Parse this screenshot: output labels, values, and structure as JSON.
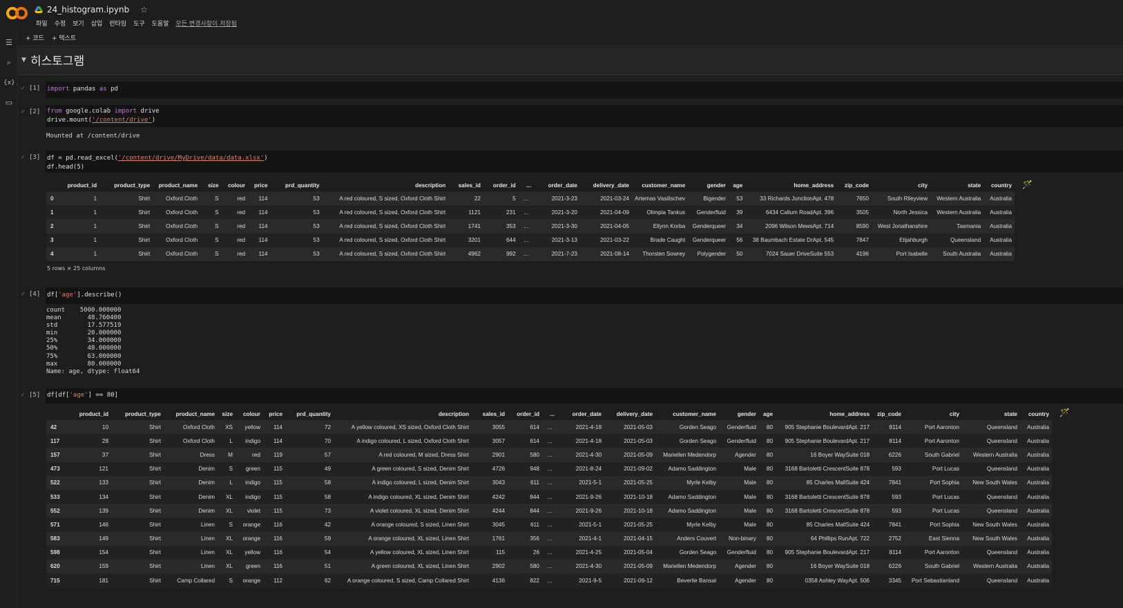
{
  "header": {
    "notebook_title": "24_histogram.ipynb",
    "menu": [
      "파일",
      "수정",
      "보기",
      "삽입",
      "런타임",
      "도구",
      "도움말"
    ],
    "save_status": "모든 변경사항이 저장됨"
  },
  "toolbar": {
    "add_code": "+ 코드",
    "add_text": "+ 텍스트"
  },
  "section": {
    "title": "히스토그램"
  },
  "cells": {
    "c1": {
      "exec": "[1]",
      "kw1": "import",
      "mid": " pandas ",
      "kw2": "as",
      "end": " pd"
    },
    "c2": {
      "exec": "[2]",
      "kw1": "from",
      "mid1": " google.colab ",
      "kw2": "import",
      "end1": " drive",
      "l2a": "drive.mount(",
      "l2str": "'/content/drive'",
      "l2b": ")",
      "output": "Mounted at /content/drive"
    },
    "c3": {
      "exec": "[3]",
      "l1a": "df = pd.read_excel(",
      "l1str": "'/content/drive/MyDrive/data/data.xlsx'",
      "l1b": ")",
      "l2": "df.head(5)",
      "shape_note": "5 rows × 25 columns"
    },
    "c4": {
      "exec": "[4]",
      "l1a": "df[",
      "l1str": "'age'",
      "l1b": "].describe()",
      "output": "count    5000.000000\nmean       48.760400\nstd        17.577519\nmin        20.000000\n25%        34.000000\n50%        48.000000\n75%        63.000000\nmax        80.000000\nName: age, dtype: float64"
    },
    "c5": {
      "exec": "[5]",
      "l1a": "df[df[",
      "l1str": "'age'",
      "l1b": "] == 80]"
    }
  },
  "table1": {
    "columns": [
      "",
      "product_id",
      "product_type",
      "product_name",
      "size",
      "colour",
      "price",
      "prd_quantity",
      "description",
      "sales_id",
      "order_id",
      "...",
      "order_date",
      "delivery_date",
      "customer_name",
      "gender",
      "age",
      "home_address",
      "zip_code",
      "city",
      "state",
      "country"
    ],
    "rows": [
      [
        "0",
        "1",
        "Shirt",
        "Oxford Cloth",
        "S",
        "red",
        "114",
        "53",
        "A red coloured, S sized, Oxford Cloth Shirt",
        "22",
        "5",
        "...",
        "2021-3-23",
        "2021-03-24",
        "Artemas Vasilischev",
        "Bigender",
        "53",
        "33 Richards JunctionApt. 478",
        "7650",
        "South Rileyview",
        "Western Australia",
        "Australia"
      ],
      [
        "1",
        "1",
        "Shirt",
        "Oxford Cloth",
        "S",
        "red",
        "114",
        "53",
        "A red coloured, S sized, Oxford Cloth Shirt",
        "1121",
        "231",
        "...",
        "2021-3-20",
        "2021-04-09",
        "Olimpia Tankus",
        "Genderfluid",
        "39",
        "6434 Callum RoadApt. 396",
        "3505",
        "North Jessica",
        "Western Australia",
        "Australia"
      ],
      [
        "2",
        "1",
        "Shirt",
        "Oxford Cloth",
        "S",
        "red",
        "114",
        "53",
        "A red coloured, S sized, Oxford Cloth Shirt",
        "1741",
        "353",
        "...",
        "2021-3-30",
        "2021-04-05",
        "Ellynn Korba",
        "Genderqueer",
        "34",
        "2096 Wilson MewsApt. 714",
        "8590",
        "West Jonathanshire",
        "Tasmania",
        "Australia"
      ],
      [
        "3",
        "1",
        "Shirt",
        "Oxford Cloth",
        "S",
        "red",
        "114",
        "53",
        "A red coloured, S sized, Oxford Cloth Shirt",
        "3201",
        "644",
        "...",
        "2021-3-13",
        "2021-03-22",
        "Brade Caught",
        "Genderqueer",
        "56",
        "38 Baumbach Estate DrApt. 545",
        "7847",
        "Elijahburgh",
        "Queensland",
        "Australia"
      ],
      [
        "4",
        "1",
        "Shirt",
        "Oxford Cloth",
        "S",
        "red",
        "114",
        "53",
        "A red coloured, S sized, Oxford Cloth Shirt",
        "4962",
        "992",
        "...",
        "2021-7-23",
        "2021-08-14",
        "Thorsten Sowrey",
        "Polygender",
        "50",
        "7024 Sauer DriveSuite 553",
        "4196",
        "Port Isabelle",
        "South Australia",
        "Australia"
      ]
    ]
  },
  "table2": {
    "columns": [
      "",
      "product_id",
      "product_type",
      "product_name",
      "size",
      "colour",
      "price",
      "prd_quantity",
      "description",
      "sales_id",
      "order_id",
      "...",
      "order_date",
      "delivery_date",
      "customer_name",
      "gender",
      "age",
      "home_address",
      "zip_code",
      "city",
      "state",
      "country"
    ],
    "rows": [
      [
        "42",
        "10",
        "Shirt",
        "Oxford Cloth",
        "XS",
        "yellow",
        "114",
        "72",
        "A yellow coloured, XS sized, Oxford Cloth Shirt",
        "3055",
        "614",
        "...",
        "2021-4-18",
        "2021-05-03",
        "Gorden Seago",
        "Genderfluid",
        "80",
        "905 Stephanie BoulevardApt. 217",
        "8114",
        "Port Aaronton",
        "Queensland",
        "Australia"
      ],
      [
        "117",
        "28",
        "Shirt",
        "Oxford Cloth",
        "L",
        "indigo",
        "114",
        "70",
        "A indigo coloured, L sized, Oxford Cloth Shirt",
        "3057",
        "614",
        "...",
        "2021-4-18",
        "2021-05-03",
        "Gorden Seago",
        "Genderfluid",
        "80",
        "905 Stephanie BoulevardApt. 217",
        "8114",
        "Port Aaronton",
        "Queensland",
        "Australia"
      ],
      [
        "157",
        "37",
        "Shirt",
        "Dress",
        "M",
        "red",
        "119",
        "57",
        "A red coloured, M sized, Dress Shirt",
        "2901",
        "580",
        "...",
        "2021-4-30",
        "2021-05-09",
        "Mariellen Medendorp",
        "Agender",
        "80",
        "16 Boyer WaySuite 018",
        "6226",
        "South Gabriel",
        "Western Australia",
        "Australia"
      ],
      [
        "473",
        "121",
        "Shirt",
        "Denim",
        "S",
        "green",
        "115",
        "49",
        "A green coloured, S sized, Denim Shirt",
        "4726",
        "948",
        "...",
        "2021-8-24",
        "2021-09-02",
        "Adamo Saddington",
        "Male",
        "80",
        "3168 Bartoletti CrescentSuite 878",
        "593",
        "Port Lucas",
        "Queensland",
        "Australia"
      ],
      [
        "522",
        "133",
        "Shirt",
        "Denim",
        "L",
        "indigo",
        "115",
        "58",
        "A indigo coloured, L sized, Denim Shirt",
        "3043",
        "611",
        "...",
        "2021-5-1",
        "2021-05-25",
        "Myrle Kelby",
        "Male",
        "80",
        "85 Charles MallSuite 424",
        "7841",
        "Port Sophia",
        "New South Wales",
        "Australia"
      ],
      [
        "533",
        "134",
        "Shirt",
        "Denim",
        "XL",
        "indigo",
        "115",
        "58",
        "A indigo coloured, XL sized, Denim Shirt",
        "4242",
        "844",
        "...",
        "2021-9-26",
        "2021-10-18",
        "Adamo Saddington",
        "Male",
        "80",
        "3168 Bartoletti CrescentSuite 878",
        "593",
        "Port Lucas",
        "Queensland",
        "Australia"
      ],
      [
        "552",
        "139",
        "Shirt",
        "Denim",
        "XL",
        "violet",
        "115",
        "73",
        "A violet coloured, XL sized, Denim Shirt",
        "4244",
        "844",
        "...",
        "2021-9-26",
        "2021-10-18",
        "Adamo Saddington",
        "Male",
        "80",
        "3168 Bartoletti CrescentSuite 878",
        "593",
        "Port Lucas",
        "Queensland",
        "Australia"
      ],
      [
        "571",
        "146",
        "Shirt",
        "Linen",
        "S",
        "orange",
        "116",
        "42",
        "A orange coloured, S sized, Linen Shirt",
        "3045",
        "611",
        "...",
        "2021-5-1",
        "2021-05-25",
        "Myrle Kelby",
        "Male",
        "80",
        "85 Charles MallSuite 424",
        "7841",
        "Port Sophia",
        "New South Wales",
        "Australia"
      ],
      [
        "583",
        "149",
        "Shirt",
        "Linen",
        "XL",
        "orange",
        "116",
        "59",
        "A orange coloured, XL sized, Linen Shirt",
        "1761",
        "356",
        "...",
        "2021-4-1",
        "2021-04-15",
        "Anders Couvert",
        "Non-binary",
        "80",
        "64 Phillips RunApt. 722",
        "2752",
        "East Sienna",
        "New South Wales",
        "Australia"
      ],
      [
        "598",
        "154",
        "Shirt",
        "Linen",
        "XL",
        "yellow",
        "116",
        "54",
        "A yellow coloured, XL sized, Linen Shirt",
        "115",
        "26",
        "...",
        "2021-4-25",
        "2021-05-04",
        "Gorden Seago",
        "Genderfluid",
        "80",
        "905 Stephanie BoulevardApt. 217",
        "8114",
        "Port Aaronton",
        "Queensland",
        "Australia"
      ],
      [
        "620",
        "159",
        "Shirt",
        "Linen",
        "XL",
        "green",
        "116",
        "51",
        "A green coloured, XL sized, Linen Shirt",
        "2902",
        "580",
        "...",
        "2021-4-30",
        "2021-05-09",
        "Mariellen Medendorp",
        "Agender",
        "80",
        "16 Boyer WaySuite 018",
        "6226",
        "South Gabriel",
        "Western Australia",
        "Australia"
      ],
      [
        "715",
        "181",
        "Shirt",
        "Camp Collared",
        "S",
        "orange",
        "112",
        "62",
        "A orange coloured, S sized, Camp Collared Shirt",
        "4136",
        "822",
        "...",
        "2021-9-5",
        "2021-09-12",
        "Beverlie Bansal",
        "Agender",
        "80",
        "0358 Ashley WayApt. 506",
        "3345",
        "Port Sebastianland",
        "Queensland",
        "Australia"
      ]
    ]
  }
}
